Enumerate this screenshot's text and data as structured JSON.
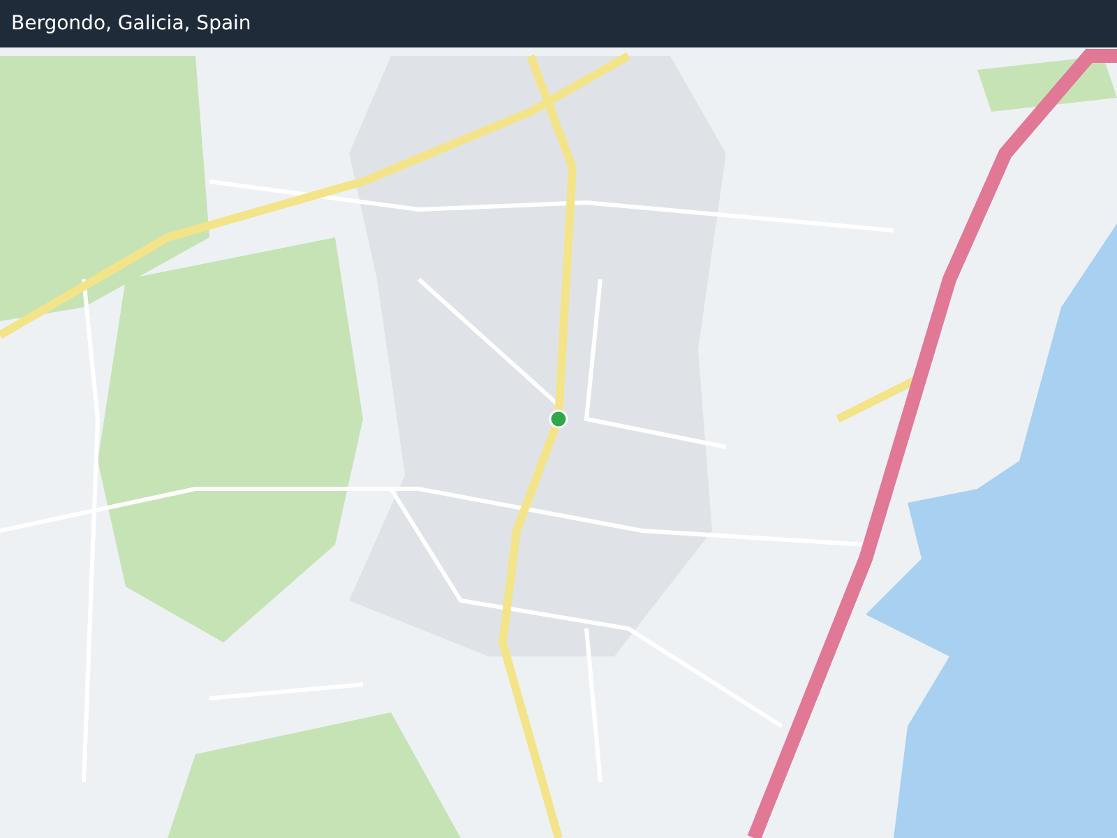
{
  "header": {
    "title": "Bergondo, Galicia, Spain"
  }
}
